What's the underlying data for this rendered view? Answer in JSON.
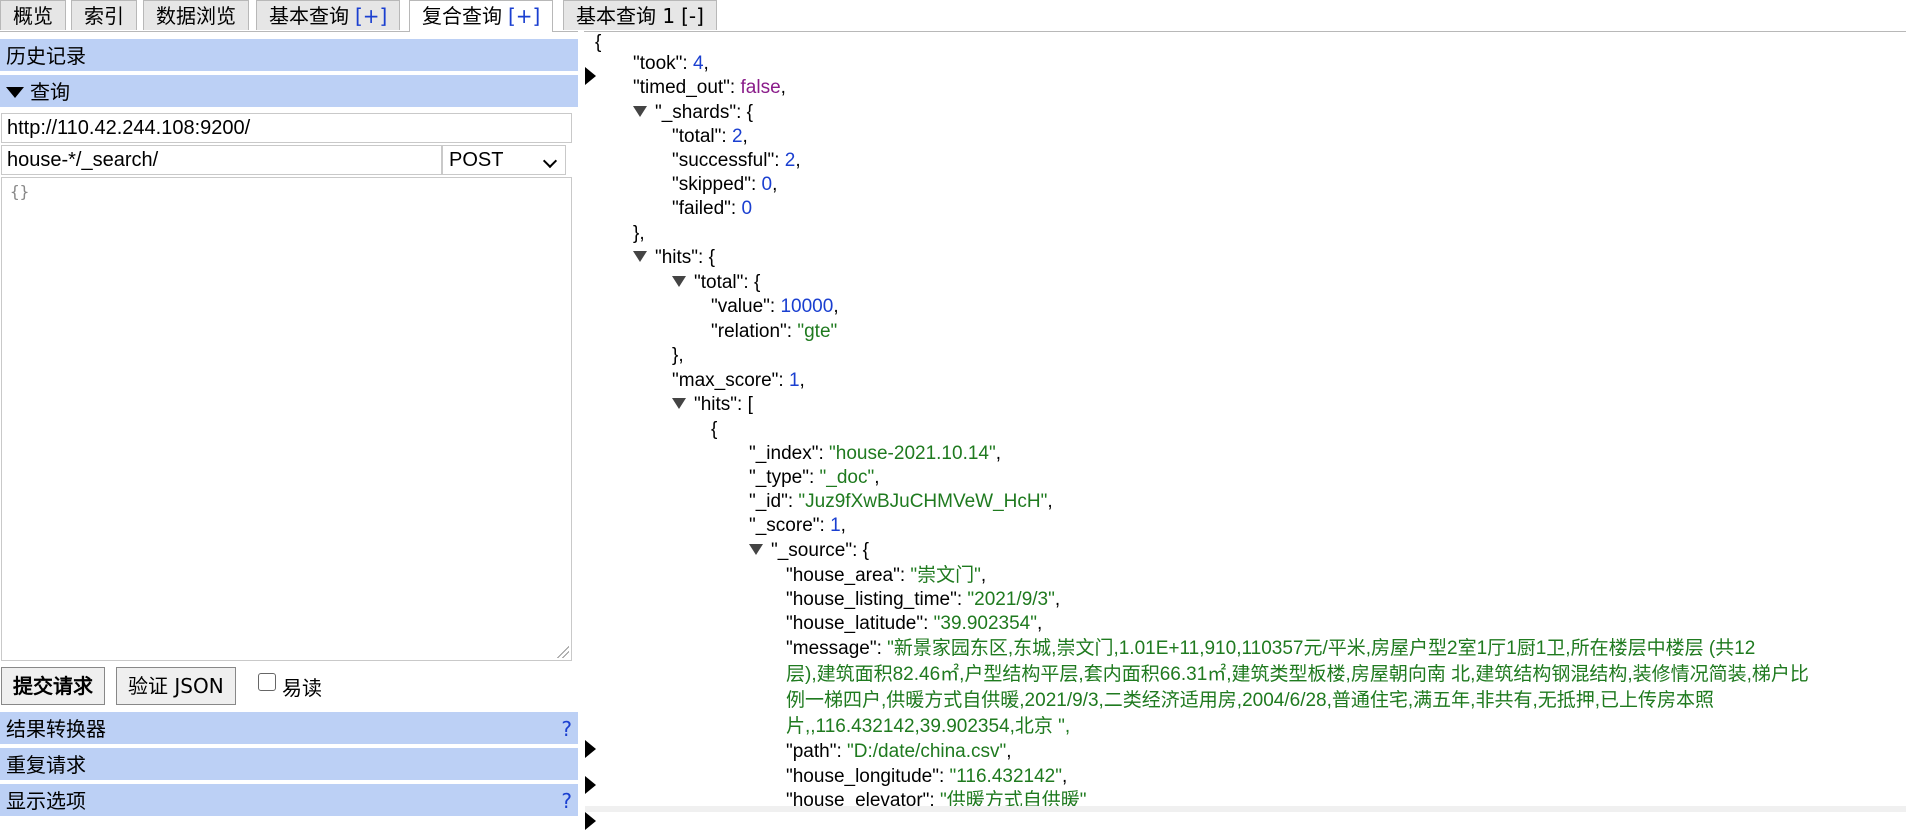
{
  "tabs": [
    {
      "label": "概览"
    },
    {
      "label": "索引"
    },
    {
      "label": "数据浏览"
    },
    {
      "label": "基本查询",
      "plus": "[+]"
    },
    {
      "label": "复合查询",
      "plus": "[+]"
    },
    {
      "label": "基本查询 1",
      "minus": "[-]"
    }
  ],
  "left": {
    "history_label": "历史记录",
    "query_label": "查询",
    "url_value": "http://110.42.244.108:9200/",
    "path_value": "house-*/_search/",
    "method_value": "POST",
    "body_value": "{}",
    "submit_label": "提交请求",
    "validate_label": "验证 JSON",
    "easy_read_label": "易读",
    "result_transformer_label": "结果转换器",
    "repeat_request_label": "重复请求",
    "display_options_label": "显示选项",
    "help_mark": "?"
  },
  "json": {
    "took": "4",
    "timed_out": "false",
    "shards_total": "2",
    "shards_successful": "2",
    "shards_skipped": "0",
    "shards_failed": "0",
    "hits_total_value": "10000",
    "hits_total_relation": "\"gte\"",
    "max_score": "1",
    "hit_index": "\"house-2021.10.14\"",
    "hit_type": "\"_doc\"",
    "hit_id": "\"Juz9fXwBJuCHMVeW_HcH\"",
    "hit_score": "1",
    "house_area": "\"崇文门\"",
    "house_listing_time": "\"2021/9/3\"",
    "house_latitude": "\"39.902354\"",
    "message_l1": "\"新景家园东区,东城,崇文门,1.01E+11,910,110357元/平米,房屋户型2室1厅1厨1卫,所在楼层中楼层 (共12",
    "message_l2": "层),建筑面积82.46㎡,户型结构平层,套内面积66.31㎡,建筑类型板楼,房屋朝向南 北,建筑结构钢混结构,装修情况简装,梯户比",
    "message_l3": "例一梯四户,供暖方式自供暖,2021/9/3,二类经济适用房,2004/6/28,普通住宅,满五年,非共有,无抵押,已上传房本照",
    "message_l4": "片,,116.432142,39.902354,北京 \",",
    "path": "\"D:/date/china.csv\"",
    "house_longitude": "\"116.432142\"",
    "house_elevator": "\"供暖方式自供暖\""
  }
}
